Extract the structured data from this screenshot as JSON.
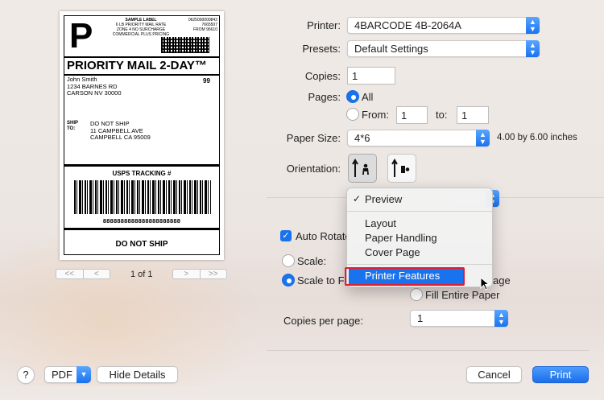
{
  "preview": {
    "label": {
      "big_letter": "P",
      "sample_text": "SAMPLE LABEL",
      "rate_lines": [
        "6 LB PRIORITY MAIL RATE",
        "ZONE 4 NO SURCHARGE",
        "COMMERCIAL PLUS PRICING"
      ],
      "code_lines": [
        "0625000000842",
        "7665507",
        "FROM 96610"
      ],
      "service": "PRIORITY MAIL 2-DAY™",
      "from_lines": [
        "John Smith",
        "1234 BARNES RD",
        "CARSON NV 30000"
      ],
      "from_code": "99",
      "ship_to_label": "SHIP TO:",
      "ship_to_lines": [
        "DO NOT SHIP",
        "11 CAMPBELL AVE",
        "CAMPBELL CA 95009"
      ],
      "tracking_title": "USPS TRACKING #",
      "tracking_number": "8888888888888888888888",
      "footer": "DO NOT SHIP"
    },
    "pager": {
      "first": "<<",
      "prev": "<",
      "next": ">",
      "last": ">>",
      "count": "1 of 1"
    }
  },
  "form": {
    "printer_label": "Printer:",
    "printer_value": "4BARCODE 4B-2064A",
    "presets_label": "Presets:",
    "presets_value": "Default Settings",
    "copies_label": "Copies:",
    "copies_value": "1",
    "pages_label": "Pages:",
    "pages_all": "All",
    "pages_from": "From:",
    "pages_from_value": "1",
    "pages_to": "to:",
    "pages_to_value": "1",
    "paper_size_label": "Paper Size:",
    "paper_size_value": "4*6",
    "paper_size_desc": "4.00 by 6.00 inches",
    "orientation_label": "Orientation:",
    "auto_rotate": "Auto Rotate",
    "scale_label": "Scale:",
    "scale_to_fit": "Scale to Fit:",
    "print_entire_suffix": "age",
    "fill_entire": "Fill Entire Paper",
    "copies_per_page_label": "Copies per page:",
    "copies_per_page_value": "1"
  },
  "menu": {
    "checked_item": "Preview",
    "items": [
      "Layout",
      "Paper Handling",
      "Cover Page"
    ],
    "highlighted_item": "Printer Features"
  },
  "footer": {
    "help": "?",
    "pdf": "PDF",
    "hide_details": "Hide Details",
    "cancel": "Cancel",
    "print": "Print"
  },
  "colors": {
    "accent": "#1a73ee",
    "highlight_border": "#e11d2b"
  }
}
